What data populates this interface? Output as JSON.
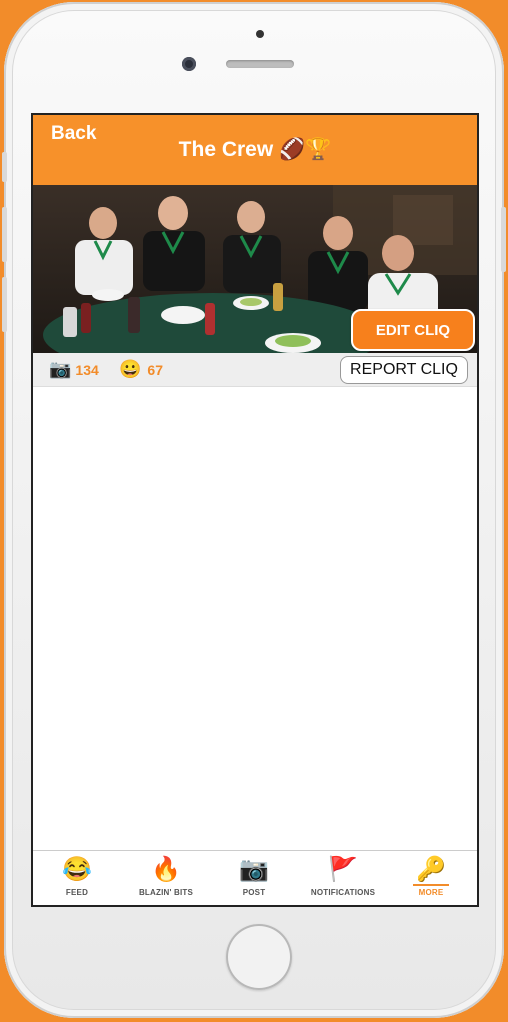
{
  "nav": {
    "back_label": "Back",
    "title": "The Crew 🏈🏆"
  },
  "cliq": {
    "edit_label": "EDIT CLIQ",
    "report_label": "REPORT CLIQ",
    "photo_count": "134",
    "member_count": "67",
    "photo_icon": "📷",
    "member_icon": "😀"
  },
  "tabs": [
    {
      "label": "FEED",
      "icon": "😂",
      "active": false
    },
    {
      "label": "BLAZIN' BITS",
      "icon": "🔥",
      "active": false
    },
    {
      "label": "POST",
      "icon": "📷",
      "active": false
    },
    {
      "label": "NOTIFICATIONS",
      "icon": "🚩",
      "active": false
    },
    {
      "label": "MORE",
      "icon": "🔑",
      "active": true
    }
  ],
  "colors": {
    "accent": "#f7912a",
    "background": "#f28c2a"
  }
}
